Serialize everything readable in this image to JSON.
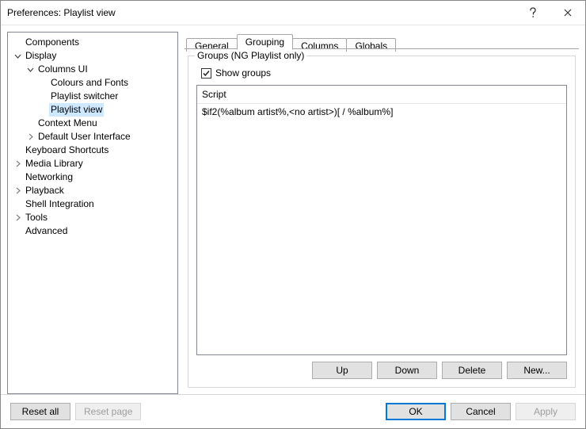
{
  "window": {
    "title": "Preferences: Playlist view"
  },
  "tree": {
    "items": [
      {
        "label": "Components",
        "depth": 0,
        "expander": "none"
      },
      {
        "label": "Display",
        "depth": 0,
        "expander": "open"
      },
      {
        "label": "Columns UI",
        "depth": 1,
        "expander": "open"
      },
      {
        "label": "Colours and Fonts",
        "depth": 2,
        "expander": "leaf"
      },
      {
        "label": "Playlist switcher",
        "depth": 2,
        "expander": "leaf"
      },
      {
        "label": "Playlist view",
        "depth": 2,
        "expander": "leaf",
        "selected": true
      },
      {
        "label": "Context Menu",
        "depth": 1,
        "expander": "leaf"
      },
      {
        "label": "Default User Interface",
        "depth": 1,
        "expander": "closed"
      },
      {
        "label": "Keyboard Shortcuts",
        "depth": 0,
        "expander": "none"
      },
      {
        "label": "Media Library",
        "depth": 0,
        "expander": "closed"
      },
      {
        "label": "Networking",
        "depth": 0,
        "expander": "none"
      },
      {
        "label": "Playback",
        "depth": 0,
        "expander": "closed"
      },
      {
        "label": "Shell Integration",
        "depth": 0,
        "expander": "none"
      },
      {
        "label": "Tools",
        "depth": 0,
        "expander": "closed"
      },
      {
        "label": "Advanced",
        "depth": 0,
        "expander": "none"
      }
    ]
  },
  "tabs": {
    "items": [
      {
        "label": "General",
        "active": false
      },
      {
        "label": "Grouping",
        "active": true
      },
      {
        "label": "Columns",
        "active": false
      },
      {
        "label": "Globals",
        "active": false
      }
    ]
  },
  "groupbox": {
    "legend": "Groups (NG Playlist only)",
    "show_groups_label": "Show groups",
    "show_groups_checked": true,
    "list_header": "Script",
    "list_rows": [
      "$if2(%album artist%,<no artist>)[ / %album%]"
    ],
    "buttons": {
      "up": "Up",
      "down": "Down",
      "delete": "Delete",
      "new": "New..."
    }
  },
  "bottom": {
    "reset_all": "Reset all",
    "reset_page": "Reset page",
    "ok": "OK",
    "cancel": "Cancel",
    "apply": "Apply"
  }
}
